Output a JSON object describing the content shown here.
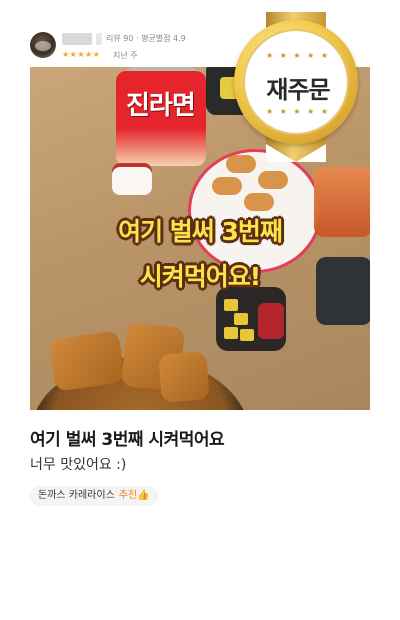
{
  "review": {
    "reviewer_stats": "리뷰 90 · 평균별점 4.9",
    "stars": "★★★★★",
    "posted": "지난 주",
    "title": "여기 벌써 3번째 시켜먹어요",
    "body": "너무 맛있어요 :)",
    "menu_tag": "돈까스 카레라이스",
    "recommend_label": "추천👍"
  },
  "badge": {
    "label": "재주문",
    "stars": "★ ★ ★ ★ ★"
  },
  "photo": {
    "overlay_line1": "여기 벌써 3번째",
    "overlay_line2": "시켜먹어요!",
    "ramen_label": "진라면"
  },
  "colors": {
    "accent_gold": "#f2c94c",
    "star": "#f5a623",
    "recommend": "#f08a1c"
  }
}
